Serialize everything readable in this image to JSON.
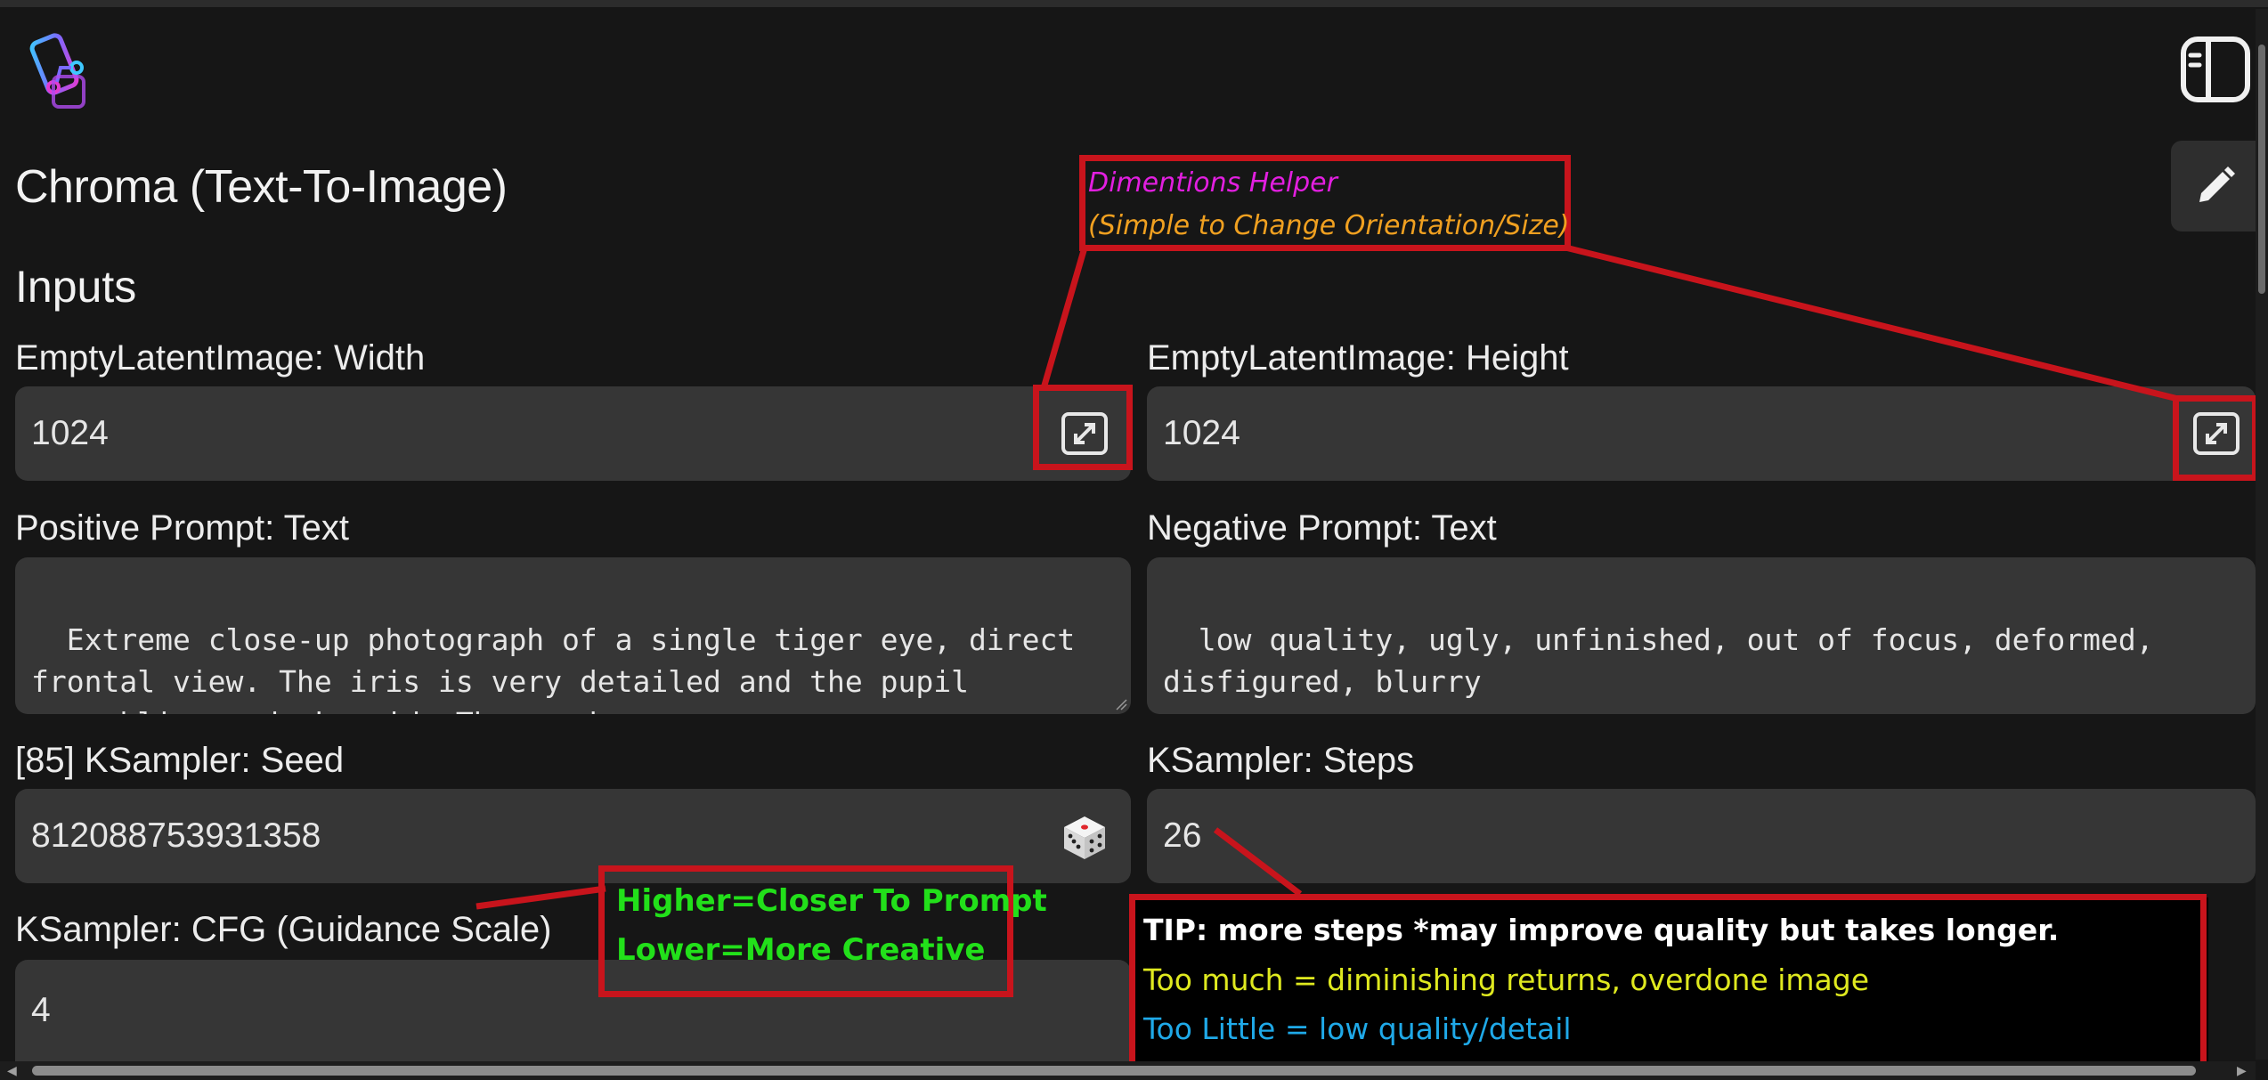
{
  "header": {
    "logo_icon": "phone-nodes-logo-icon",
    "panel_toggle_icon": "sidebar-panel-icon",
    "edit_icon": "pencil-icon"
  },
  "app_title": "Chroma (Text-To-Image)",
  "section_title": "Inputs",
  "fields": {
    "width": {
      "label": "EmptyLatentImage: Width",
      "value": "1024",
      "action_icon": "expand-icon"
    },
    "height": {
      "label": "EmptyLatentImage: Height",
      "value": "1024",
      "action_icon": "expand-icon"
    },
    "positive_prompt": {
      "label": "Positive Prompt: Text",
      "value": "Extreme close-up photograph of a single tiger eye, direct frontal view. The iris is very detailed and the pupil resembling a dark void. The word"
    },
    "negative_prompt": {
      "label": "Negative Prompt: Text",
      "value": "low quality, ugly, unfinished, out of focus, deformed, disfigured, blurry"
    },
    "seed": {
      "label": "[85] KSampler: Seed",
      "value": "812088753931358",
      "action_icon": "dice-icon"
    },
    "steps": {
      "label": "KSampler: Steps",
      "value": "26"
    },
    "cfg": {
      "label": "KSampler: CFG (Guidance Scale)",
      "value": "4"
    }
  },
  "annotations": {
    "dimensions_helper": {
      "line1": "Dimentions Helper",
      "line2": "(Simple to Change Orientation/Size)"
    },
    "cfg_hint": {
      "line1": "Higher=Closer To Prompt",
      "line2": "Lower=More Creative"
    },
    "steps_tip": {
      "line1": "TIP: more steps *may improve quality but takes longer.",
      "line2": "Too much = diminishing returns, overdone image",
      "line3": "Too Little = low quality/detail"
    }
  },
  "colors": {
    "background": "#161616",
    "input_bg": "#363636",
    "annotation_red": "#c8141c",
    "note_pink": "#e21fe0",
    "note_orange": "#f0a020",
    "note_green": "#22e01a",
    "tip_yellow": "#dfe91f",
    "tip_blue": "#1fa9e8"
  }
}
